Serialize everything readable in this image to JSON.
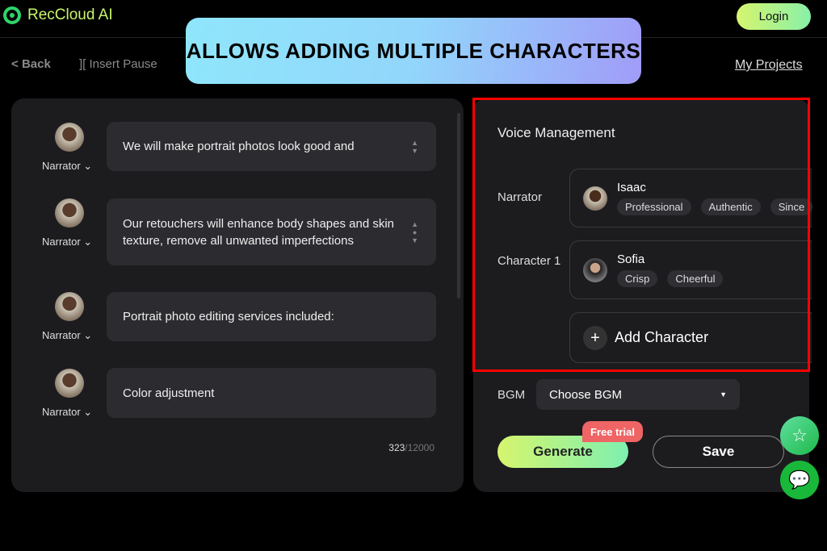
{
  "header": {
    "app_name": "RecCloud AI",
    "login": "Login",
    "back": "Back",
    "insert_pause": "Insert Pause",
    "my_projects": "My Projects"
  },
  "banner": "ALLOWS ADDING MULTIPLE CHARACTERS",
  "script": {
    "lines": [
      {
        "speaker": "Narrator",
        "text": "We will make portrait photos look good and"
      },
      {
        "speaker": "Narrator",
        "text": "Our retouchers will enhance body shapes and skin texture, remove all unwanted imperfections"
      },
      {
        "speaker": "Narrator",
        "text": "Portrait photo editing services included:"
      },
      {
        "speaker": "Narrator",
        "text": "Color adjustment"
      }
    ],
    "count": "323",
    "max": "/12000"
  },
  "voice": {
    "title": "Voice Management",
    "narrator": {
      "label": "Narrator",
      "name": "Isaac",
      "tags": [
        "Professional",
        "Authentic",
        "Since"
      ]
    },
    "character": {
      "label": "Character 1",
      "name": "Sofia",
      "tags": [
        "Crisp",
        "Cheerful"
      ]
    },
    "add": "Add Character"
  },
  "bgm": {
    "label": "BGM",
    "value": "Choose BGM"
  },
  "actions": {
    "generate": "Generate",
    "free_trial": "Free trial",
    "save": "Save"
  }
}
